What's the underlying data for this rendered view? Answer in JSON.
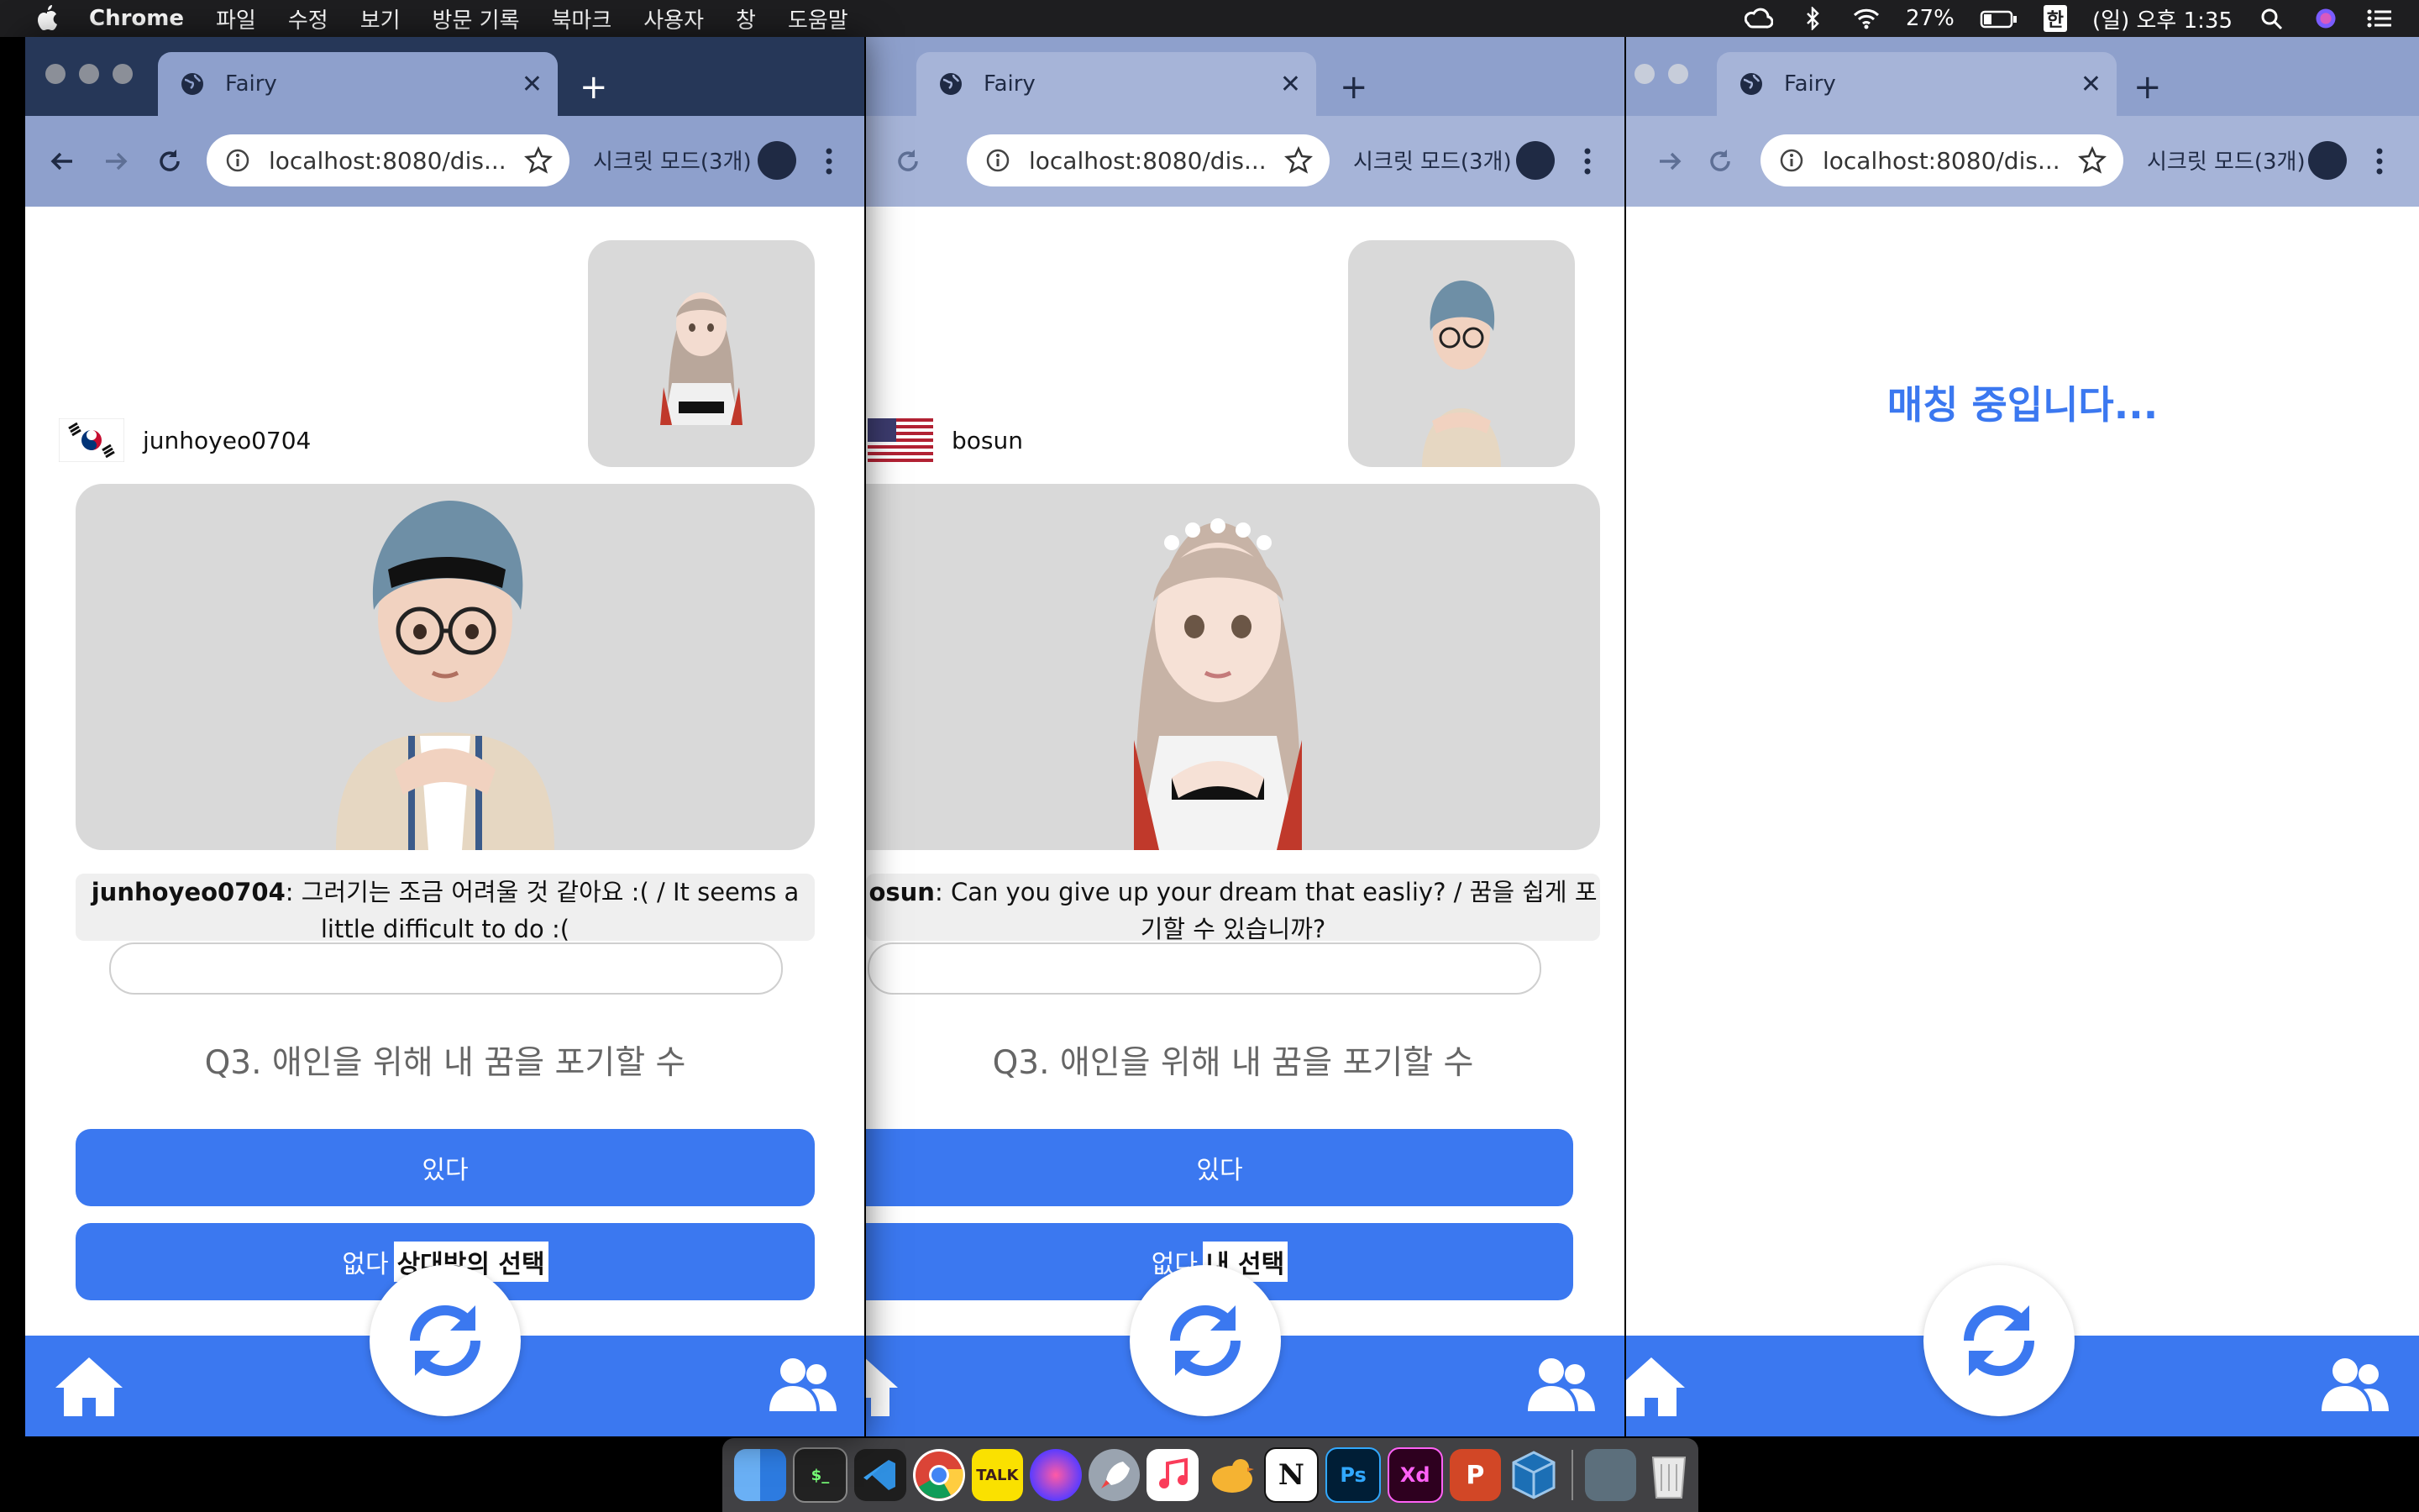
{
  "menubar": {
    "app": "Chrome",
    "menus": [
      "파일",
      "수정",
      "보기",
      "방문 기록",
      "북마크",
      "사용자",
      "창",
      "도움말"
    ],
    "battery": "27%",
    "input_source": "한",
    "clock": "(일) 오후 1:35"
  },
  "browser": {
    "tab_title": "Fairy",
    "url": "localhost:8080/dis...",
    "incognito_label": "시크릿 모드(3개)"
  },
  "windows": [
    {
      "user_name": "junhoyeo0704",
      "flag": "korea",
      "chat_sender": "junhoyeo0704",
      "chat_message": ": 그러기는 조금 어려울 것 같아요 :( / It seems a little difficult to do :(",
      "question": "Q3. 애인을 위해 내 꿈을 포기할 수",
      "option_yes": "있다",
      "option_no": "없다",
      "option_no_tag": "상대방의 선택"
    },
    {
      "user_name": "bosun",
      "flag": "usa",
      "chat_sender": "osun",
      "chat_message": ": Can you give up your dream that easliy? / 꿈을 쉽게 포기할 수 있습니까?",
      "question": "Q3. 애인을 위해 내 꿈을 포기할 수",
      "option_yes": "있다",
      "option_no": "없다",
      "option_no_tag": "내 선택"
    },
    {
      "status": "매칭 중입니다..."
    }
  ],
  "colors": {
    "primary": "#3b78f0",
    "cam_bg": "#d9d9d9",
    "tab_active_strip": "#263758",
    "tab_bar": "#8ea0cc"
  },
  "dock": {
    "apps": [
      "finder-icon",
      "terminal-icon",
      "vscode-icon",
      "chrome-icon",
      "kakaotalk-icon",
      "siri-icon",
      "launchpad-icon",
      "music-icon",
      "cyberduck-icon",
      "notion-icon",
      "photoshop-icon",
      "xd-icon",
      "powerpoint-icon",
      "virtualbox-icon",
      "screenshot-folder-icon",
      "trash-icon"
    ],
    "labels": {
      "kakao": "TALK",
      "notion": "N",
      "ps": "Ps",
      "xd": "Xd",
      "ppt": "P"
    }
  }
}
